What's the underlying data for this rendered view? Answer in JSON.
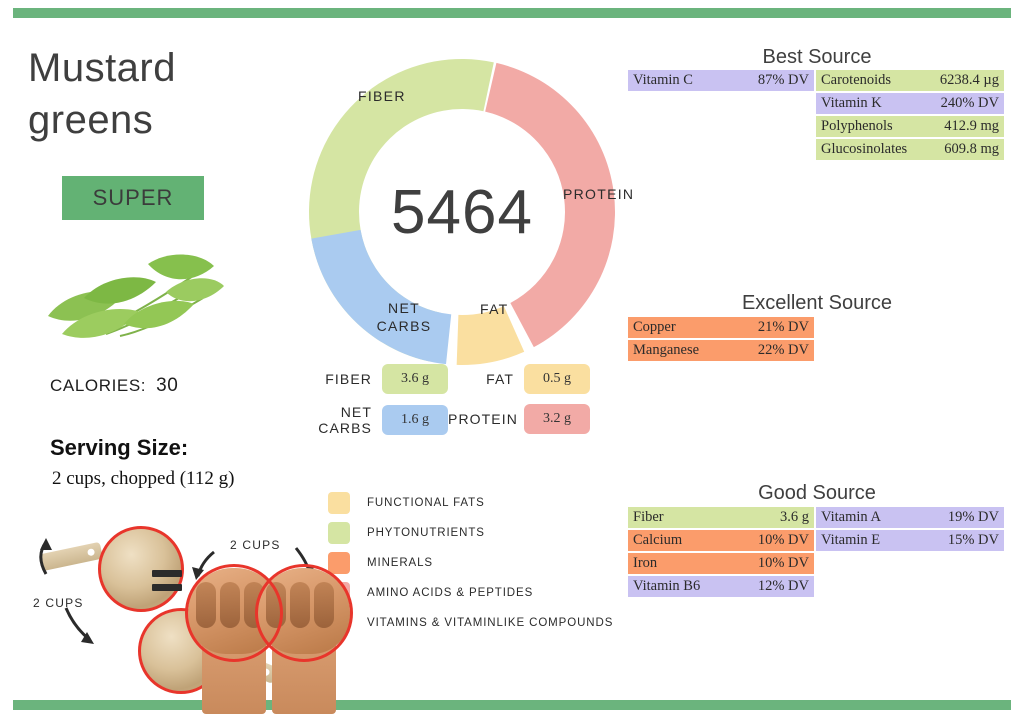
{
  "colors": {
    "bar_green": "#6bb47d",
    "badge_green": "#63b274",
    "fats_yellow": "#fadfa0",
    "phyto_green": "#d5e5a3",
    "minerals_orange": "#fb9c6b",
    "amino_salmon": "#f2aaa6",
    "vitamins_purple": "#c9c2f2",
    "netcarbs_blue": "#aacbf0",
    "text_dark": "#3b3b3b"
  },
  "header": {
    "title_line1": "Mustard",
    "title_line2": "greens",
    "badge": "SUPER"
  },
  "facts": {
    "calories_label": "CALORIES:",
    "calories_value": "30",
    "serving_label": "Serving Size:",
    "serving_value": "2 cups, chopped (112 g)"
  },
  "cups": {
    "label_left": "2 CUPS",
    "label_right": "2 CUPS",
    "equals": "="
  },
  "chart_data": {
    "type": "pie",
    "title": "5464",
    "center_value": "5464",
    "categories": [
      "FIBER",
      "PROTEIN",
      "FAT",
      "NET CARBS"
    ],
    "values": [
      3.6,
      3.2,
      0.5,
      1.6
    ],
    "units": "g",
    "colors": [
      "#d5e5a3",
      "#f2aaa6",
      "#fadfa0",
      "#aacbf0"
    ],
    "segments": [
      {
        "label": "FIBER",
        "value": 3.6,
        "display": "3.6 g",
        "color": "#d5e5a3",
        "start_deg": 192,
        "end_deg": 372
      },
      {
        "label": "PROTEIN",
        "value": 3.2,
        "display": "3.2 g",
        "color": "#f2aaa6",
        "start_deg": 13,
        "end_deg": 152
      },
      {
        "label": "FAT",
        "value": 0.5,
        "display": "0.5 g",
        "color": "#fadfa0",
        "start_deg": 156,
        "end_deg": 182
      },
      {
        "label": "NET CARBS",
        "value": 1.6,
        "display": "1.6 g",
        "color": "#aacbf0",
        "start_deg": 186,
        "end_deg": 260
      }
    ],
    "legend_position": "below-left",
    "grid": false
  },
  "macros": [
    {
      "label": "FIBER",
      "value": "3.6 g",
      "color": "#d5e5a3"
    },
    {
      "label": "FAT",
      "value": "0.5 g",
      "color": "#fadfa0"
    },
    {
      "label_line1": "NET",
      "label_line2": "CARBS",
      "label": "NET CARBS",
      "value": "1.6 g",
      "color": "#aacbf0"
    },
    {
      "label": "PROTEIN",
      "value": "3.2 g",
      "color": "#f2aaa6"
    }
  ],
  "legend": [
    {
      "label": "FUNCTIONAL  FATS",
      "color": "#fadfa0"
    },
    {
      "label": "PHYTONUTRIENTS",
      "color": "#d5e5a3"
    },
    {
      "label": "MINERALS",
      "color": "#fb9c6b"
    },
    {
      "label": "AMINO ACIDS & PEPTIDES",
      "color": "#f2aaa6"
    },
    {
      "label": "VITAMINS & VITAMINLIKE COMPOUNDS",
      "color": "#c9c2f2"
    }
  ],
  "sources": {
    "best": {
      "title": "Best Source",
      "left": [
        {
          "name": "Vitamin C",
          "value": "87% DV",
          "color": "#c9c2f2"
        }
      ],
      "right": [
        {
          "name": "Carotenoids",
          "value": "6238.4 µg",
          "color": "#d5e5a3"
        },
        {
          "name": "Vitamin K",
          "value": "240% DV",
          "color": "#c9c2f2"
        },
        {
          "name": "Polyphenols",
          "value": "412.9 mg",
          "color": "#d5e5a3"
        },
        {
          "name": "Glucosinolates",
          "value": "609.8 mg",
          "color": "#d5e5a3"
        }
      ]
    },
    "excellent": {
      "title": "Excellent Source",
      "left": [
        {
          "name": "Copper",
          "value": "21% DV",
          "color": "#fb9c6b"
        },
        {
          "name": "Manganese",
          "value": "22% DV",
          "color": "#fb9c6b"
        }
      ],
      "right": []
    },
    "good": {
      "title": "Good Source",
      "left": [
        {
          "name": "Fiber",
          "value": "3.6 g",
          "color": "#d5e5a3"
        },
        {
          "name": "Calcium",
          "value": "10% DV",
          "color": "#fb9c6b"
        },
        {
          "name": "Iron",
          "value": "10% DV",
          "color": "#fb9c6b"
        },
        {
          "name": "Vitamin B6",
          "value": "12% DV",
          "color": "#c9c2f2"
        }
      ],
      "right": [
        {
          "name": "Vitamin A",
          "value": "19% DV",
          "color": "#c9c2f2"
        },
        {
          "name": "Vitamin E",
          "value": "15% DV",
          "color": "#c9c2f2"
        }
      ]
    }
  }
}
